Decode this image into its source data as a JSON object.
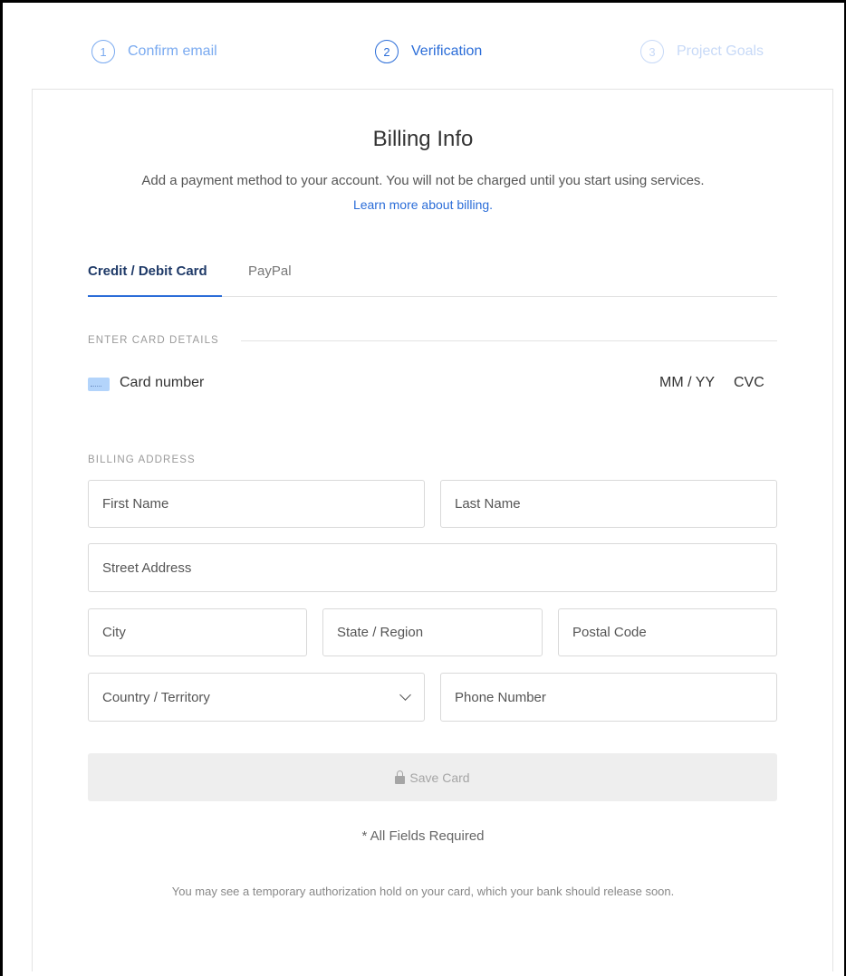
{
  "stepper": {
    "steps": [
      {
        "number": "1",
        "label": "Confirm email"
      },
      {
        "number": "2",
        "label": "Verification"
      },
      {
        "number": "3",
        "label": "Project Goals"
      }
    ],
    "active_step": 2
  },
  "header": {
    "title": "Billing Info",
    "subtitle": "Add a payment method to your account. You will not be charged until you start using services.",
    "learn_link": "Learn more about billing."
  },
  "tabs": [
    {
      "label": "Credit / Debit Card",
      "active": true
    },
    {
      "label": "PayPal",
      "active": false
    }
  ],
  "card_section": {
    "heading": "ENTER CARD DETAILS",
    "card_number_placeholder": "Card number",
    "expiry_placeholder": "MM / YY",
    "cvc_placeholder": "CVC",
    "icon": "credit-card-icon"
  },
  "billing_section": {
    "heading": "BILLING ADDRESS",
    "fields": {
      "first_name": "First Name",
      "last_name": "Last Name",
      "street": "Street Address",
      "city": "City",
      "state": "State / Region",
      "postal": "Postal Code",
      "country": "Country / Territory",
      "phone": "Phone Number"
    }
  },
  "save_button": {
    "label": "Save Card",
    "icon": "lock-icon",
    "enabled": false
  },
  "footer": {
    "required_note": "* All Fields Required",
    "hold_note": "You may see a temporary authorization hold on your card, which your bank should release soon."
  },
  "colors": {
    "accent": "#2b6dd8",
    "tab_active": "#1f3a68",
    "button_disabled_bg": "#eeeeee"
  }
}
